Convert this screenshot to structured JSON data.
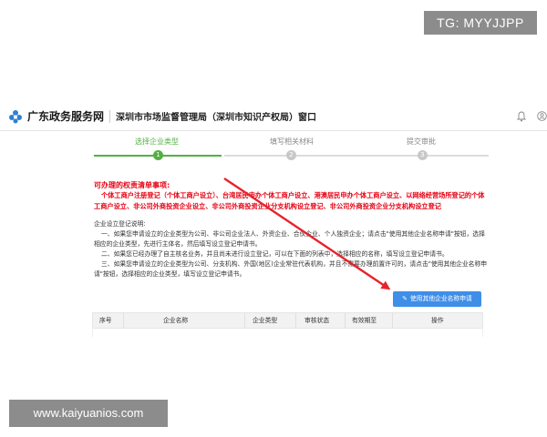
{
  "watermarks": {
    "top": "TG: MYYJJPP",
    "bottom": "www.kaiyuanios.com"
  },
  "header": {
    "brand": "广东政务服务网",
    "window_title": "深圳市市场监督管理局（深圳市知识产权局）窗口"
  },
  "steps": [
    {
      "label": "选择企业类型",
      "number": "1",
      "active": true
    },
    {
      "label": "填写相关材料",
      "number": "2",
      "active": false
    },
    {
      "label": "提交审批",
      "number": "3",
      "active": false
    }
  ],
  "notice": {
    "title": "可办理的权责清单事项:",
    "body": "个体工商户注册登记（个体工商户设立）、台湾居民申办个体工商户设立、港澳居民申办个体工商户设立、以网络经营场所登记的个体工商户设立、非公司外商投资企业设立、非公司外商投资企业分支机构设立登记、非公司外商投资企业分支机构设立登记"
  },
  "description": {
    "heading": "企业设立登记说明:",
    "items": [
      "一、如果您申请设立的企业类型为公司、非公司企业法人、外资企业、合伙企业、个人独资企业；请点击\"使用其他企业名称申请\"按钮，选择相应的企业类型，先进行主体名，然后填写设立登记申请书。",
      "二、如果您已经办理了自主核名业务，并且尚未进行设立登记，可以在下面的列表中，选择相应的名称，填写设立登记申请书。",
      "三、如果您申请设立的企业类型为公司、分支机构、外国(地区)企业常驻代表机构，并且不需要办理前置许可的，请点击\"使用其他企业名称申请\"按钮，选择相应的企业类型，填写设立登记申请书。"
    ]
  },
  "apply_button": {
    "label": "使用其他企业名称申请"
  },
  "table": {
    "columns": [
      "序号",
      "企业名称",
      "企业类型",
      "审核状态",
      "有效期至",
      "操作"
    ]
  },
  "colors": {
    "accent_green": "#52b043",
    "button_blue": "#3f8ee8",
    "notice_red": "#e60012",
    "arrow_red": "#e8232c"
  }
}
